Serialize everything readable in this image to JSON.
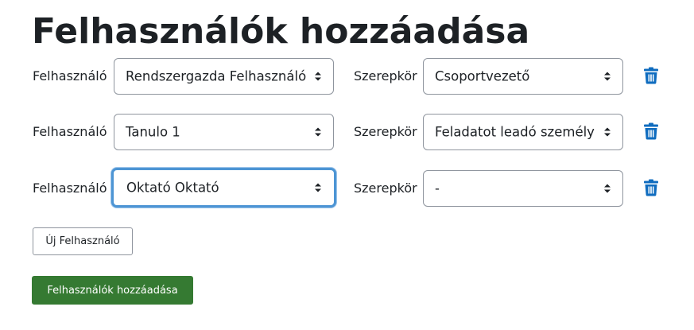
{
  "page": {
    "title": "Felhasználók hozzáadása"
  },
  "rows": [
    {
      "user_label": "Felhasználó",
      "user_value": "Rendszergazda Felhasználó",
      "role_label": "Szerepkör",
      "role_value": "Csoportvezető",
      "delete_icon": "trash-icon"
    },
    {
      "user_label": "Felhasználó",
      "user_value": "Tanulo 1",
      "role_label": "Szerepkör",
      "role_value": "Feladatot leadó személy",
      "delete_icon": "trash-icon"
    },
    {
      "user_label": "Felhasználó",
      "user_value": "Oktató Oktató",
      "role_label": "Szerepkör",
      "role_value": "-",
      "delete_icon": "trash-icon",
      "user_select_focused": true
    }
  ],
  "actions": {
    "new_user_label": "Új Felhasználó",
    "submit_label": "Felhasználók hozzáadása"
  },
  "colors": {
    "primary_button": "#357a32",
    "trash_icon": "#0f6cbf",
    "focus_ring": "#4d95d4",
    "text": "#1d2125",
    "border": "#8f959e"
  }
}
